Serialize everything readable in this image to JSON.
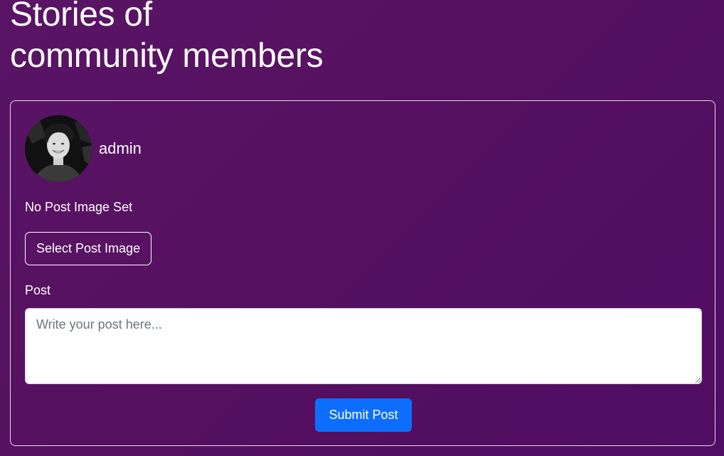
{
  "header": {
    "title": "Stories of\ncommunity members"
  },
  "composer": {
    "author_name": "admin",
    "avatar_icon": "user-avatar-photo",
    "no_image_text": "No Post Image Set",
    "select_image_label": "Select Post Image",
    "post_label": "Post",
    "post_value": "",
    "post_placeholder": "Write your post here...",
    "submit_label": "Submit Post"
  },
  "colors": {
    "background": "#57115f",
    "primary_button": "#0d6efd",
    "text": "#ffffff"
  }
}
